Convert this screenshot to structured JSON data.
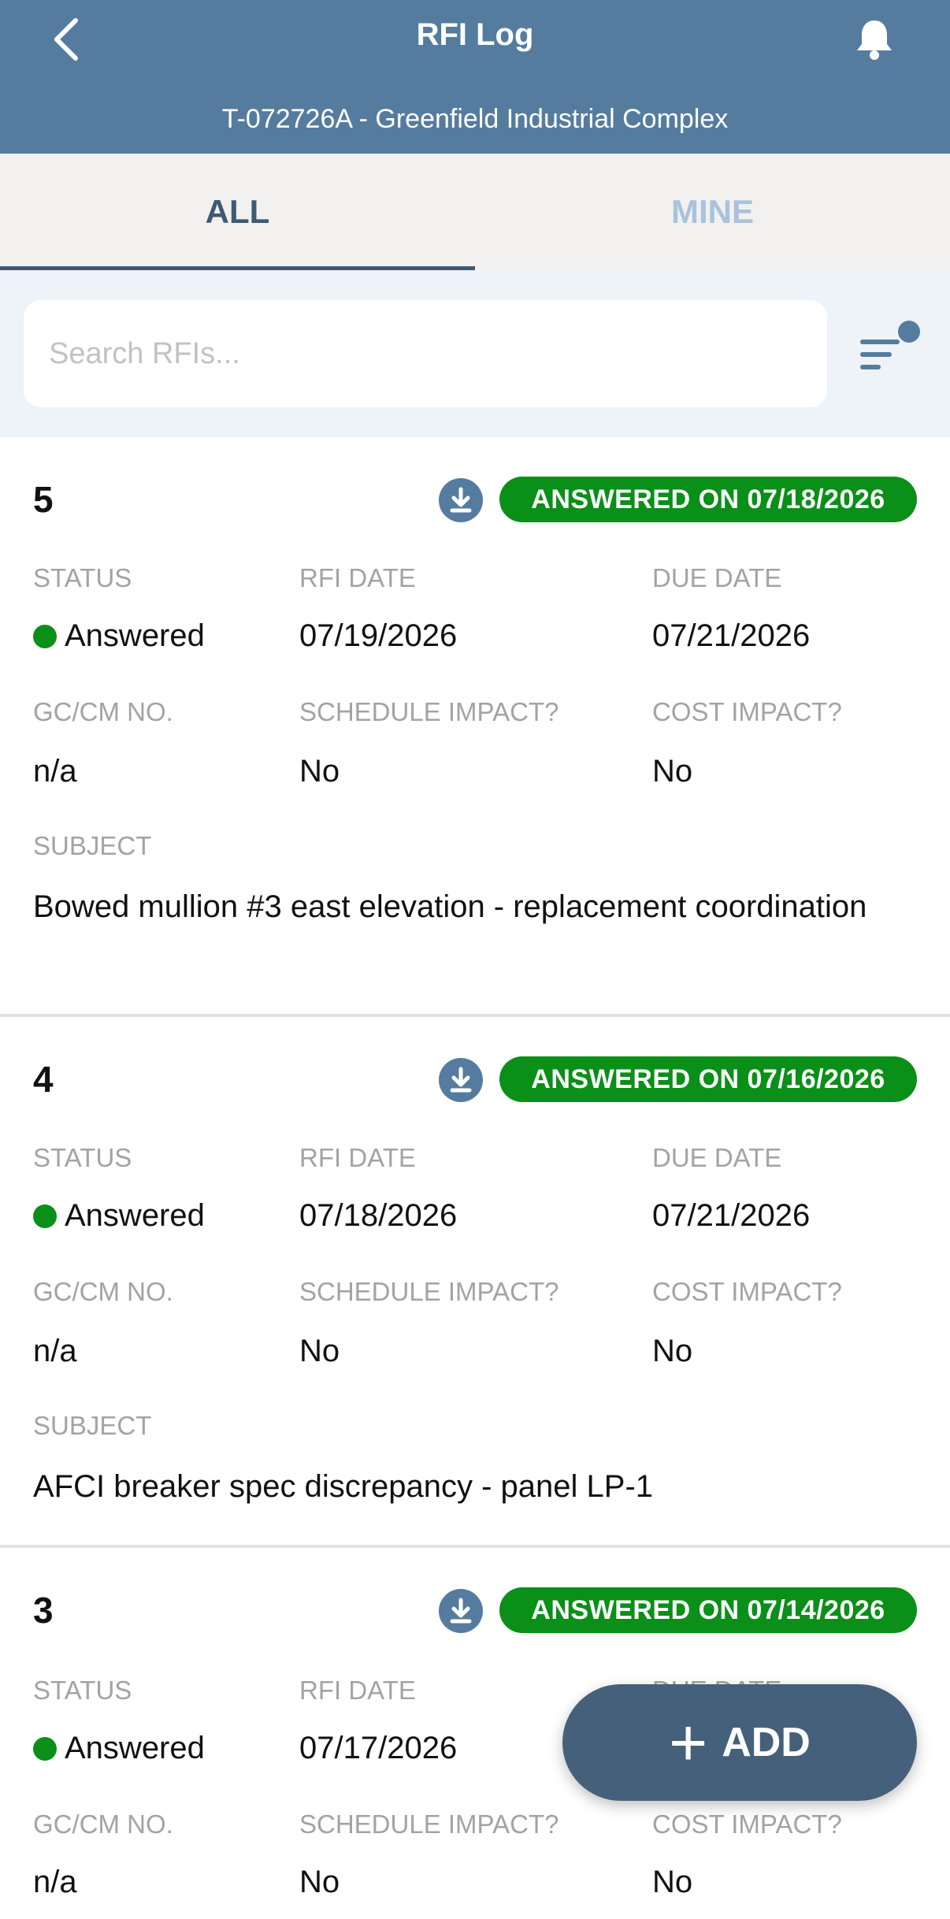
{
  "header": {
    "title": "RFI Log",
    "subtitle": "T-072726A - Greenfield Industrial Complex"
  },
  "tabs": [
    {
      "label": "ALL",
      "active": true
    },
    {
      "label": "MINE",
      "active": false
    }
  ],
  "search": {
    "placeholder": "Search RFIs..."
  },
  "labels": {
    "status": "STATUS",
    "rfi_date": "RFI DATE",
    "due_date": "DUE DATE",
    "gc_cm_no": "GC/CM NO.",
    "schedule_impact": "SCHEDULE IMPACT?",
    "cost_impact": "COST IMPACT?",
    "subject": "SUBJECT"
  },
  "rfis": [
    {
      "number": "5",
      "badge": "ANSWERED ON 07/18/2026",
      "status": "Answered",
      "rfi_date": "07/19/2026",
      "due_date": "07/21/2026",
      "gc_cm_no": "n/a",
      "schedule_impact": "No",
      "cost_impact": "No",
      "subject": "Bowed mullion #3 east elevation - replacement coordination"
    },
    {
      "number": "4",
      "badge": "ANSWERED ON 07/16/2026",
      "status": "Answered",
      "rfi_date": "07/18/2026",
      "due_date": "07/21/2026",
      "gc_cm_no": "n/a",
      "schedule_impact": "No",
      "cost_impact": "No",
      "subject": "AFCI breaker spec discrepancy - panel LP-1"
    },
    {
      "number": "3",
      "badge": "ANSWERED ON 07/14/2026",
      "status": "Answered",
      "rfi_date": "07/17/2026",
      "due_date": "DUE DATE",
      "gc_cm_no": "n/a",
      "schedule_impact": "No",
      "cost_impact": "No"
    }
  ],
  "fab": {
    "label": "ADD"
  },
  "colors": {
    "header": "#557c9e",
    "answered_green": "#0a8f18",
    "tab_active": "#3e5a74",
    "fab": "#45607a"
  }
}
